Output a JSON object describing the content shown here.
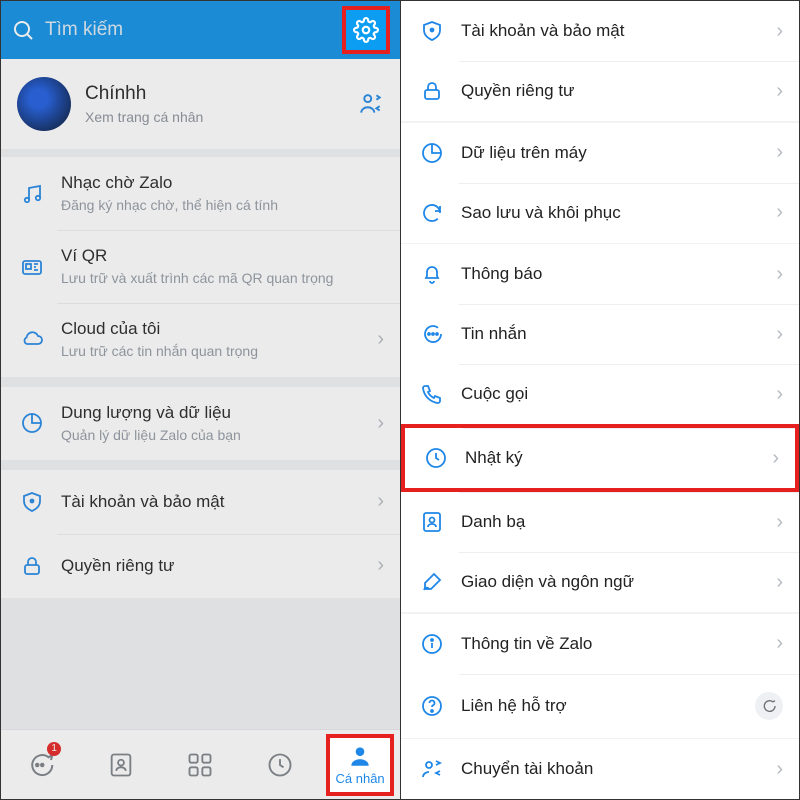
{
  "left": {
    "search_placeholder": "Tìm kiếm",
    "profile": {
      "name": "Chínhh",
      "sub": "Xem trang cá nhân"
    },
    "items": [
      {
        "key": "ringtone",
        "title": "Nhạc chờ Zalo",
        "desc": "Đăng ký nhạc chờ, thể hiện cá tính",
        "chev": false
      },
      {
        "key": "qrwallet",
        "title": "Ví QR",
        "desc": "Lưu trữ và xuất trình các mã QR quan trọng",
        "chev": false
      },
      {
        "key": "cloud",
        "title": "Cloud của tôi",
        "desc": "Lưu trữ các tin nhắn quan trọng",
        "chev": true
      },
      {
        "key": "storage",
        "title": "Dung lượng và dữ liệu",
        "desc": "Quản lý dữ liệu Zalo của bạn",
        "chev": true
      },
      {
        "key": "security",
        "title": "Tài khoản và bảo mật",
        "desc": "",
        "chev": true
      },
      {
        "key": "privacy",
        "title": "Quyền riêng tư",
        "desc": "",
        "chev": true
      }
    ],
    "nav": {
      "badge": "1",
      "active_label": "Cá nhân"
    }
  },
  "right": {
    "items": [
      {
        "key": "security",
        "title": "Tài khoản và bảo mật"
      },
      {
        "key": "privacy",
        "title": "Quyền riêng tư"
      },
      {
        "key": "devicedata",
        "title": "Dữ liệu trên máy"
      },
      {
        "key": "backup",
        "title": "Sao lưu và khôi phục"
      },
      {
        "key": "notif",
        "title": "Thông báo"
      },
      {
        "key": "message",
        "title": "Tin nhắn"
      },
      {
        "key": "call",
        "title": "Cuộc gọi"
      },
      {
        "key": "diary",
        "title": "Nhật ký"
      },
      {
        "key": "contacts",
        "title": "Danh bạ"
      },
      {
        "key": "ui",
        "title": "Giao diện và ngôn ngữ"
      },
      {
        "key": "about",
        "title": "Thông tin về Zalo"
      },
      {
        "key": "support",
        "title": "Liên hệ hỗ trợ"
      },
      {
        "key": "switch",
        "title": "Chuyển tài khoản"
      }
    ]
  }
}
